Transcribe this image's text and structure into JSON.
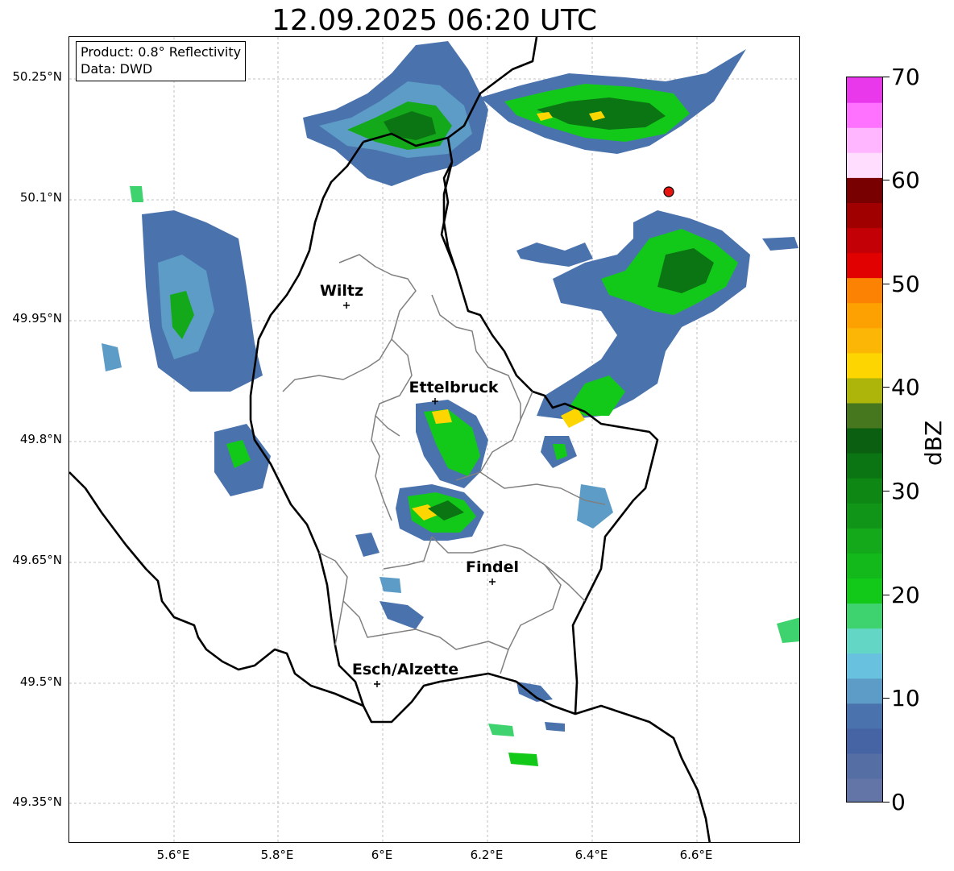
{
  "title": "12.09.2025 06:20 UTC",
  "info": {
    "product": "Product: 0.8° Reflectivity",
    "source": "Data: DWD"
  },
  "axes": {
    "lat_labels": [
      "50.25°N",
      "50.1°N",
      "49.95°N",
      "49.8°N",
      "49.65°N",
      "49.5°N",
      "49.35°N"
    ],
    "lon_labels": [
      "5.6°E",
      "5.8°E",
      "6°E",
      "6.2°E",
      "6.4°E",
      "6.6°E"
    ]
  },
  "cities": [
    {
      "name": "Wiltz",
      "lat": 49.966,
      "lon": 5.932
    },
    {
      "name": "Ettelbruck",
      "lat": 49.848,
      "lon": 6.104
    },
    {
      "name": "Findel",
      "lat": 49.626,
      "lon": 6.211
    },
    {
      "name": "Esch/Alzette",
      "lat": 49.496,
      "lon": 5.986
    }
  ],
  "marker": {
    "lat": 50.11,
    "lon": 6.543,
    "color": "#e8140f"
  },
  "colorbar": {
    "unit": "dBZ",
    "min": 0,
    "max": 70,
    "tick_labels": [
      "0",
      "10",
      "20",
      "30",
      "40",
      "50",
      "60",
      "70"
    ],
    "colors": [
      "#6374a6",
      "#556ea3",
      "#4663a3",
      "#4a73ae",
      "#5c9cc6",
      "#68c1de",
      "#63d6c5",
      "#3fd36f",
      "#12c91a",
      "#13b91a",
      "#13a91a",
      "#119518",
      "#0e8714",
      "#0b7513",
      "#0b5f10",
      "#46761e",
      "#adb50a",
      "#fdd500",
      "#fcb606",
      "#fca101",
      "#fc8203",
      "#e10100",
      "#c30005",
      "#a10000",
      "#780000",
      "#ffddff",
      "#ffb6ff",
      "#ff71ff",
      "#e937ec"
    ]
  },
  "colors": {
    "border_country": "#000000",
    "border_canton": "#808080",
    "grid": "#b0b0b0"
  }
}
